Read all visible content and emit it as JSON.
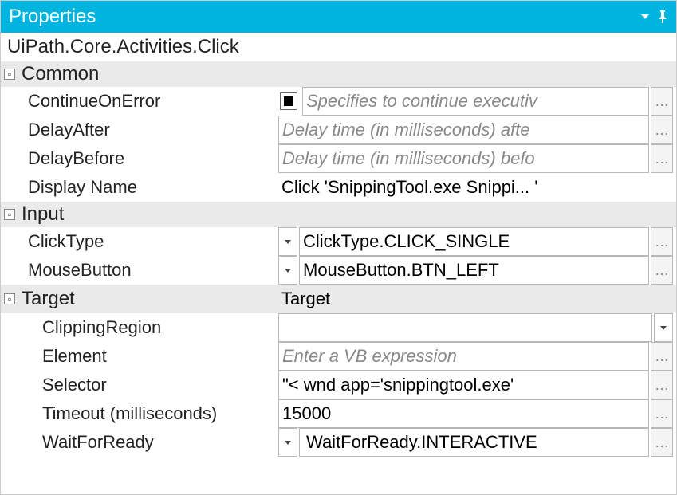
{
  "titlebar": {
    "title": "Properties"
  },
  "subtitle": "UiPath.Core.Activities.Click",
  "groups": {
    "common": {
      "label": "Common",
      "continueOnError": {
        "label": "ContinueOnError",
        "placeholder": "Specifies to continue executiv"
      },
      "delayAfter": {
        "label": "DelayAfter",
        "placeholder": "Delay time (in milliseconds) afte"
      },
      "delayBefore": {
        "label": "DelayBefore",
        "placeholder": "Delay time (in milliseconds) befo"
      },
      "displayName": {
        "label": "Display Name",
        "value": "Click 'SnippingTool.exe Snippi... '"
      }
    },
    "input": {
      "label": "Input",
      "clickType": {
        "label": "ClickType",
        "value": "ClickType.CLICK_SINGLE"
      },
      "mouseButton": {
        "label": "MouseButton",
        "value": "MouseButton.BTN_LEFT"
      }
    },
    "target": {
      "label": "Target",
      "value": "Target",
      "clippingRegion": {
        "label": "ClippingRegion",
        "value": ""
      },
      "element": {
        "label": "Element",
        "placeholder": "Enter a VB expression"
      },
      "selector": {
        "label": "Selector",
        "value": "\"< wnd app='snippingtool.exe'"
      },
      "timeout": {
        "label": "Timeout (milliseconds)",
        "value": "15000"
      },
      "waitForReady": {
        "label": "WaitForReady",
        "value": "WaitForReady.INTERACTIVE"
      }
    }
  }
}
